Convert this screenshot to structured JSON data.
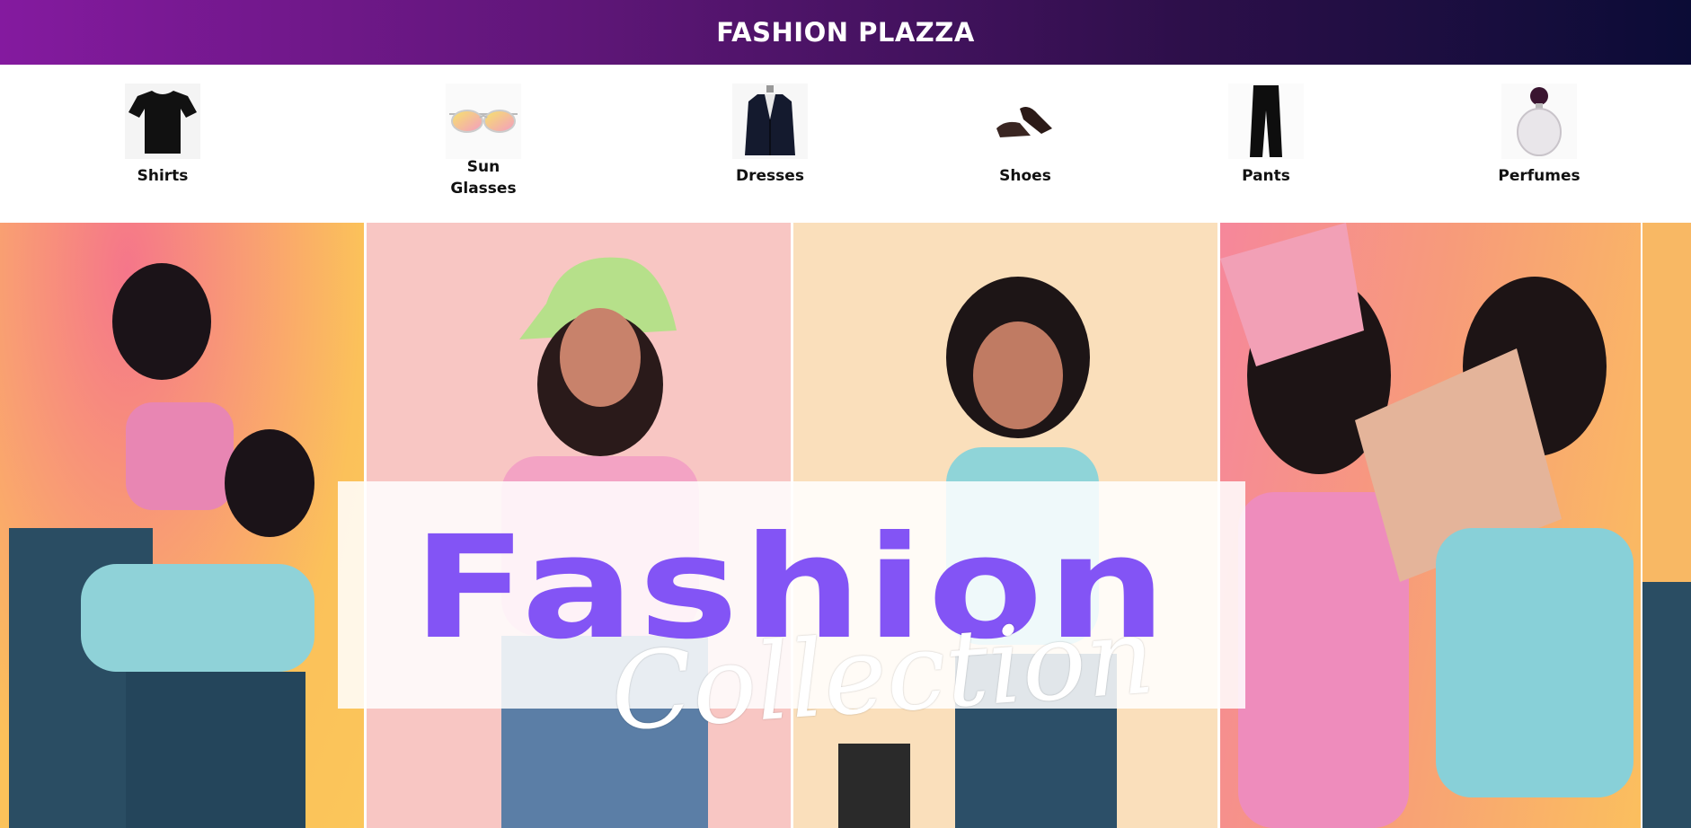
{
  "header": {
    "brand": "FASHION PLAZZA"
  },
  "categories": [
    {
      "label": "Shirts",
      "icon": "tshirt-icon"
    },
    {
      "label": "Sun\nGlasses",
      "icon": "sunglasses-icon"
    },
    {
      "label": "Dresses",
      "icon": "blazer-icon"
    },
    {
      "label": "Shoes",
      "icon": "loafers-icon"
    },
    {
      "label": "Pants",
      "icon": "pants-icon"
    },
    {
      "label": "Perfumes",
      "icon": "perfume-bottle-icon"
    }
  ],
  "hero": {
    "title": "Fashion",
    "subtitle": "Collection",
    "colors": {
      "title": "#8354f5",
      "panel_1": "#fbc15a",
      "panel_2": "#f8c6c3",
      "panel_3": "#fadfbb",
      "panel_4": "#f6879b"
    }
  }
}
